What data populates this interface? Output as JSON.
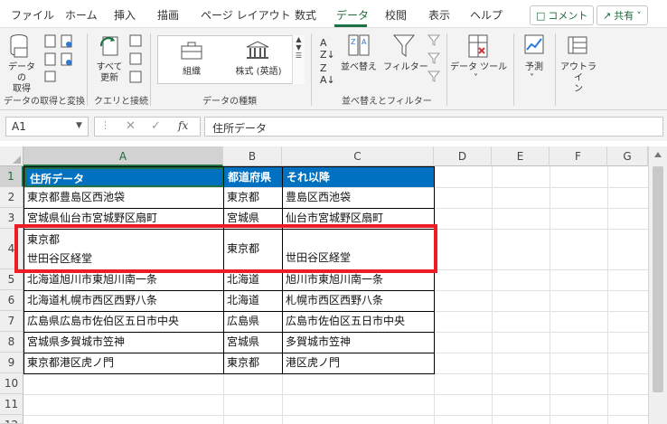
{
  "ribbon_tabs": [
    "ファイル",
    "ホーム",
    "挿入",
    "描画",
    "ページ レイアウト",
    "数式",
    "データ",
    "校閲",
    "表示",
    "ヘルプ"
  ],
  "active_tab": "データ",
  "comment_button": "コメント",
  "share_button": "共有",
  "ribbon": {
    "get_data": "データの\n取得",
    "refresh_all": "すべて\n更新",
    "stock": "株式 (英語)",
    "org": "組織",
    "sort": "並べ替え",
    "filter": "フィルター",
    "data_tools": "データ ツール",
    "forecast": "予測",
    "outline": "アウトライ\nン",
    "group_labels": [
      "データの取得と変換",
      "クエリと接続",
      "データの種類",
      "並べ替えとフィルター"
    ]
  },
  "name_box": "A1",
  "formula_value": "住所データ",
  "columns": [
    "A",
    "B",
    "C",
    "D",
    "E",
    "F",
    "G"
  ],
  "rows": [
    "1",
    "2",
    "3",
    "4",
    "5",
    "6",
    "7",
    "8",
    "9",
    "10",
    "11",
    "12"
  ],
  "table": {
    "headers": [
      "住所データ",
      "都道府県",
      "それ以降"
    ],
    "rows": [
      [
        "東京都豊島区西池袋",
        "東京都",
        "豊島区西池袋"
      ],
      [
        "宮城県仙台市宮城野区扇町",
        "宮城県",
        "仙台市宮城野区扇町"
      ],
      [
        "東京都\n世田谷区経堂",
        "東京都",
        "世田谷区経堂"
      ],
      [
        "北海道旭川市東旭川南一条",
        "北海道",
        "旭川市東旭川南一条"
      ],
      [
        "北海道札幌市西区西野八条",
        "北海道",
        "札幌市西区西野八条"
      ],
      [
        "広島県広島市佐伯区五日市中央",
        "広島県",
        "広島市佐伯区五日市中央"
      ],
      [
        "宮城県多賀城市笠神",
        "宮城県",
        "多賀城市笠神"
      ],
      [
        "東京都港区虎ノ門",
        "東京都",
        "港区虎ノ門"
      ]
    ]
  },
  "colors": {
    "accent": "#1e7145",
    "header_fill": "#0070c0",
    "highlight": "#ee1c24"
  }
}
